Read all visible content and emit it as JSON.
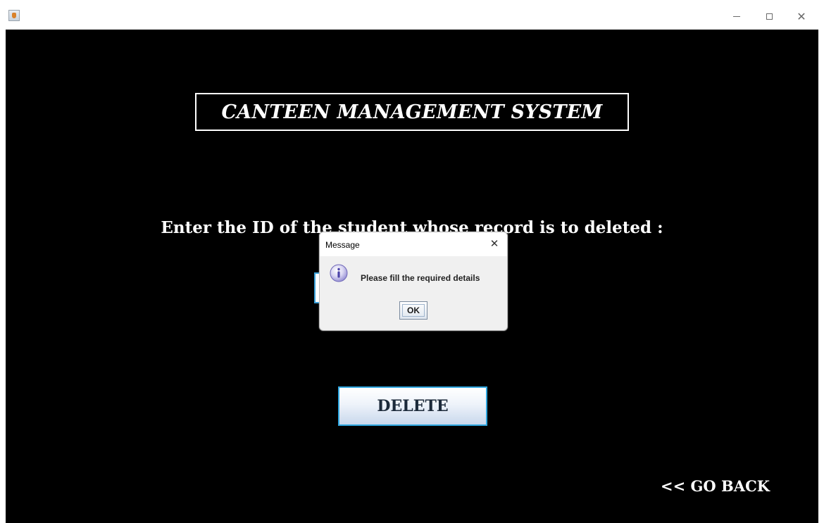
{
  "window": {
    "icon": "java-app-icon",
    "controls": {
      "minimize_icon": "minimize-icon",
      "maximize_icon": "maximize-icon",
      "close_icon": "close-icon",
      "close_glyph": "✕"
    }
  },
  "main": {
    "title": "CANTEEN MANAGEMENT SYSTEM",
    "instruction": "Enter the ID of the student whose record is to deleted :",
    "student_id_value": "",
    "delete_label": "DELETE",
    "go_back_label": "<< GO BACK"
  },
  "dialog": {
    "title": "Message",
    "close_glyph": "✕",
    "icon": "info-icon",
    "message": "Please fill the required details",
    "ok_label": "OK"
  },
  "colors": {
    "background": "#000000",
    "text": "#ffffff",
    "accent_border": "#2fa7e0",
    "dialog_background": "#f0f0f0"
  }
}
